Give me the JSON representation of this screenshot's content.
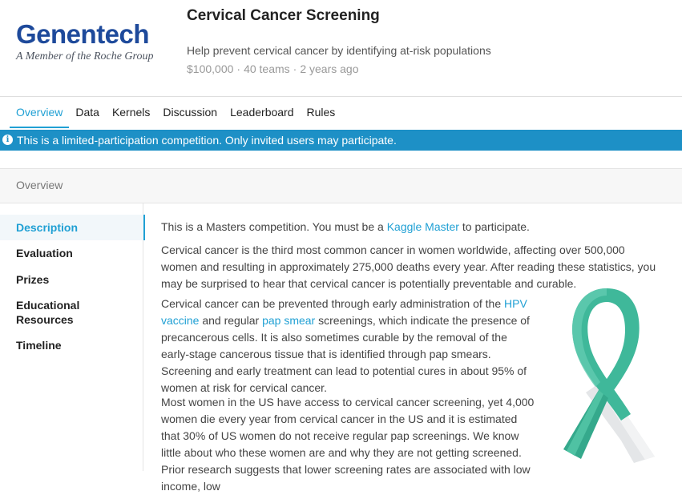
{
  "header": {
    "logo_name": "Genentech",
    "logo_tagline": "A Member of the Roche Group",
    "title": "Cervical Cancer Screening",
    "subtitle": "Help prevent cervical cancer by identifying at-risk populations",
    "prize": "$100,000",
    "teams": "40 teams",
    "age": "2 years ago",
    "brand_color": "#1e4a9b"
  },
  "tabs": [
    "Overview",
    "Data",
    "Kernels",
    "Discussion",
    "Leaderboard",
    "Rules"
  ],
  "active_tab": "Overview",
  "banner": {
    "icon": "info-icon",
    "text": "This is a limited-participation competition. Only invited users may participate.",
    "color": "#1d90c6"
  },
  "section_title": "Overview",
  "sidebar": {
    "items": [
      "Description",
      "Evaluation",
      "Prizes",
      "Educational",
      "Resources",
      "Timeline"
    ],
    "active": "Description"
  },
  "content": {
    "p1_pre": "This is a Masters competition. You must be a ",
    "p1_link": "Kaggle Master",
    "p1_post": " to participate.",
    "p2": "Cervical cancer is the third most common cancer in women worldwide, affecting over 500,000 women and resulting in approximately 275,000 deaths every year. After reading these statistics, you may be surprised to hear that cervical cancer is potentially preventable and curable.",
    "p3_a": "Cervical cancer can be prevented through early administration of the ",
    "p3_link1": "HPV vaccine",
    "p3_b": " and regular ",
    "p3_link2": "pap smear",
    "p3_c": " screenings, which indicate the presence of precancerous cells. It is also sometimes curable by the removal of the early-stage cancerous tissue that is identified through pap smears. Screening and early treatment can lead to potential cures in about 95% of women at risk for cervical cancer.",
    "p4": "Most women in the US have access to cervical cancer screening, yet 4,000 women die every year from cervical cancer in the US and it is estimated that 30% of US women do not receive regular pap screenings. We know little about who these women are and why they are not getting screened. Prior research suggests that lower screening rates are associated with low income, low",
    "link_color": "#20a0d4"
  },
  "accent_color": "#20a0d4",
  "ribbon_color": "#3fb89a"
}
